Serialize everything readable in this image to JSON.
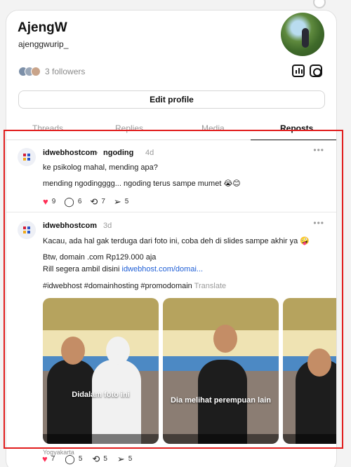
{
  "profile": {
    "name": "AjengW",
    "handle": "ajenggwurip_",
    "followers_text": "3 followers",
    "edit_button": "Edit profile",
    "icons": [
      "insights-icon",
      "instagram-icon"
    ]
  },
  "tabs": [
    {
      "label": "Threads",
      "active": false
    },
    {
      "label": "Replies",
      "active": false
    },
    {
      "label": "Media",
      "active": false
    },
    {
      "label": "Reposts",
      "active": true
    }
  ],
  "posts": [
    {
      "author": "idwebhostcom",
      "reposted_to": "ngoding",
      "time": "4d",
      "lines": [
        "ke psikolog mahal, mending apa?",
        "mending ngodingggg... ngoding terus sampe mumet 😭😊"
      ],
      "likes": "9",
      "comments": "6",
      "reposts": "7",
      "shares": "5"
    },
    {
      "author": "idwebhostcom",
      "time": "3d",
      "lines": [
        "Kacau, ada hal gak terduga dari foto ini, coba deh di slides sampe akhir ya 🤪",
        "Btw, domain .com Rp129.000 aja",
        "Rill segera ambil disini",
        "#idwebhost #domainhosting #promodomain"
      ],
      "link_text": "idwebhost.com/domai...",
      "translate": "Translate",
      "media_captions": [
        "Didalam foto ini",
        "Dia melihat perempuan lain"
      ],
      "location": "Yogyakarta",
      "likes": "7",
      "comments": "5",
      "reposts": "5",
      "shares": "5"
    }
  ],
  "colors": {
    "accent_red": "#e11d1d",
    "heart": "#ff2d55",
    "link": "#1f5fd6"
  }
}
